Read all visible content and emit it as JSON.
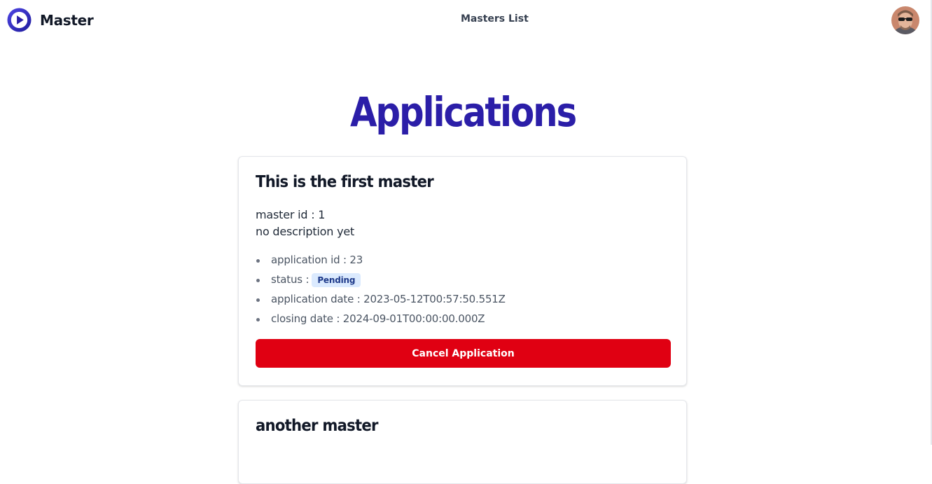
{
  "navbar": {
    "brand": "Master",
    "links": [
      "Masters List"
    ]
  },
  "page": {
    "title": "Applications"
  },
  "colors": {
    "accent": "#2b1ea8",
    "danger": "#e00012",
    "badge_bg": "#dbeafe",
    "badge_text": "#1e3a8a"
  },
  "applications": [
    {
      "title": "This is the first master",
      "master_id": "master id : 1",
      "description": "no description yet",
      "application_id": "application id : 23",
      "status_label": "status :",
      "status": "Pending",
      "application_date": "application date : 2023-05-12T00:57:50.551Z",
      "closing_date": "closing date : 2024-09-01T00:00:00.000Z",
      "cancel_label": "Cancel Application"
    },
    {
      "title": "another master"
    }
  ]
}
